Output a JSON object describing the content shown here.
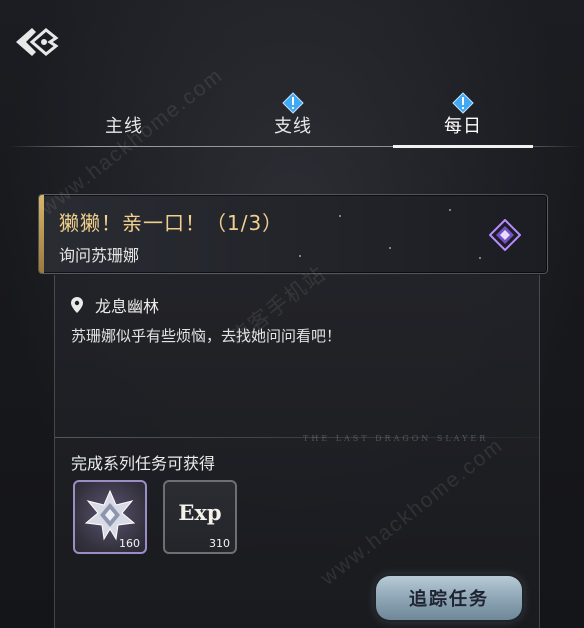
{
  "tabs": [
    {
      "label": "主线",
      "alert": false,
      "active": false
    },
    {
      "label": "支线",
      "alert": true,
      "active": false
    },
    {
      "label": "每日",
      "alert": true,
      "active": true
    }
  ],
  "quest": {
    "title": "獭獭！亲一口！（1/3）",
    "subtitle": "询问苏珊娜",
    "emblem_icon": "purple-diamond-emblem-icon"
  },
  "detail": {
    "location": "龙息幽林",
    "description": "苏珊娜似乎有些烦恼，去找她问问看吧！",
    "deco_text": "THE LAST DRAGON SLAYER"
  },
  "rewards": {
    "heading": "完成系列任务可获得",
    "items": [
      {
        "icon": "silver-crystal-icon",
        "count": "160"
      },
      {
        "label": "Exp",
        "count": "310"
      }
    ]
  },
  "actions": {
    "track_label": "追踪任务"
  },
  "watermark": {
    "url": "www.hackhome.com",
    "cn": "嗨客手机站"
  },
  "colors": {
    "accent_gold": "#f0d08c",
    "alert_blue": "#3fa9f5",
    "emblem_purple": "#b98cff",
    "button_steel": "#8ea6b6"
  }
}
